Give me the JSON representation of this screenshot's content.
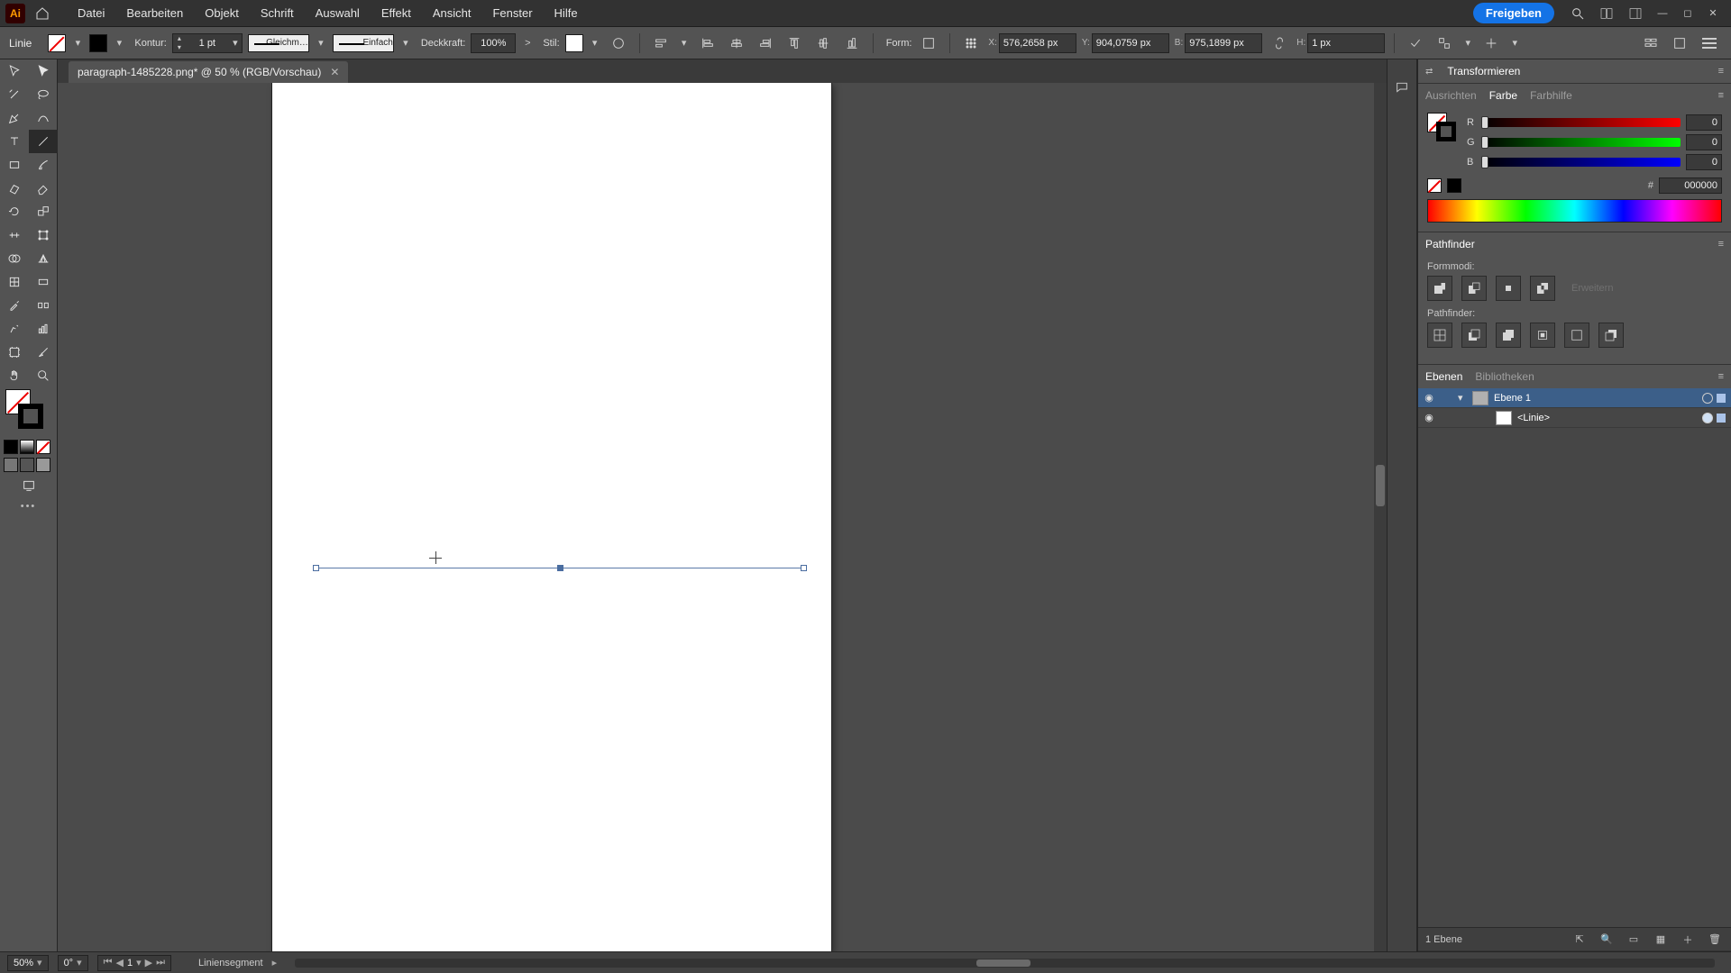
{
  "menu": {
    "items": [
      "Datei",
      "Bearbeiten",
      "Objekt",
      "Schrift",
      "Auswahl",
      "Effekt",
      "Ansicht",
      "Fenster",
      "Hilfe"
    ],
    "share": "Freigeben"
  },
  "controlbar": {
    "context": "Linie",
    "stroke_label": "Kontur:",
    "stroke_weight": "1 pt",
    "stroke_profile": "Gleichm…",
    "brush": "Einfach",
    "opacity_label": "Deckkraft:",
    "opacity_value": "100%",
    "style_label": "Stil:",
    "shape_label": "Form:",
    "x_label": "X:",
    "x_value": "576,2658 px",
    "y_label": "Y:",
    "y_value": "904,0759 px",
    "w_label": "B:",
    "w_value": "975,1899 px",
    "h_label": "H:",
    "h_value": "1 px"
  },
  "document": {
    "tab_title": "paragraph-1485228.png* @ 50 % (RGB/Vorschau)"
  },
  "panels": {
    "transform_tab": "Transformieren",
    "color_tabs": [
      "Ausrichten",
      "Farbe",
      "Farbhilfe"
    ],
    "color": {
      "r": "0",
      "g": "0",
      "b": "0",
      "hex": "000000"
    },
    "pathfinder_title": "Pathfinder",
    "pathfinder_shape_label": "Formmodi:",
    "pathfinder_pf_label": "Pathfinder:",
    "pathfinder_expand": "Erweitern",
    "layers_tabs": [
      "Ebenen",
      "Bibliotheken"
    ],
    "layers": {
      "layer1_name": "Ebene 1",
      "obj1_name": "<Linie>",
      "count": "1 Ebene"
    }
  },
  "status": {
    "zoom": "50%",
    "rotation": "0°",
    "artboard": "1",
    "tool": "Liniensegment"
  }
}
